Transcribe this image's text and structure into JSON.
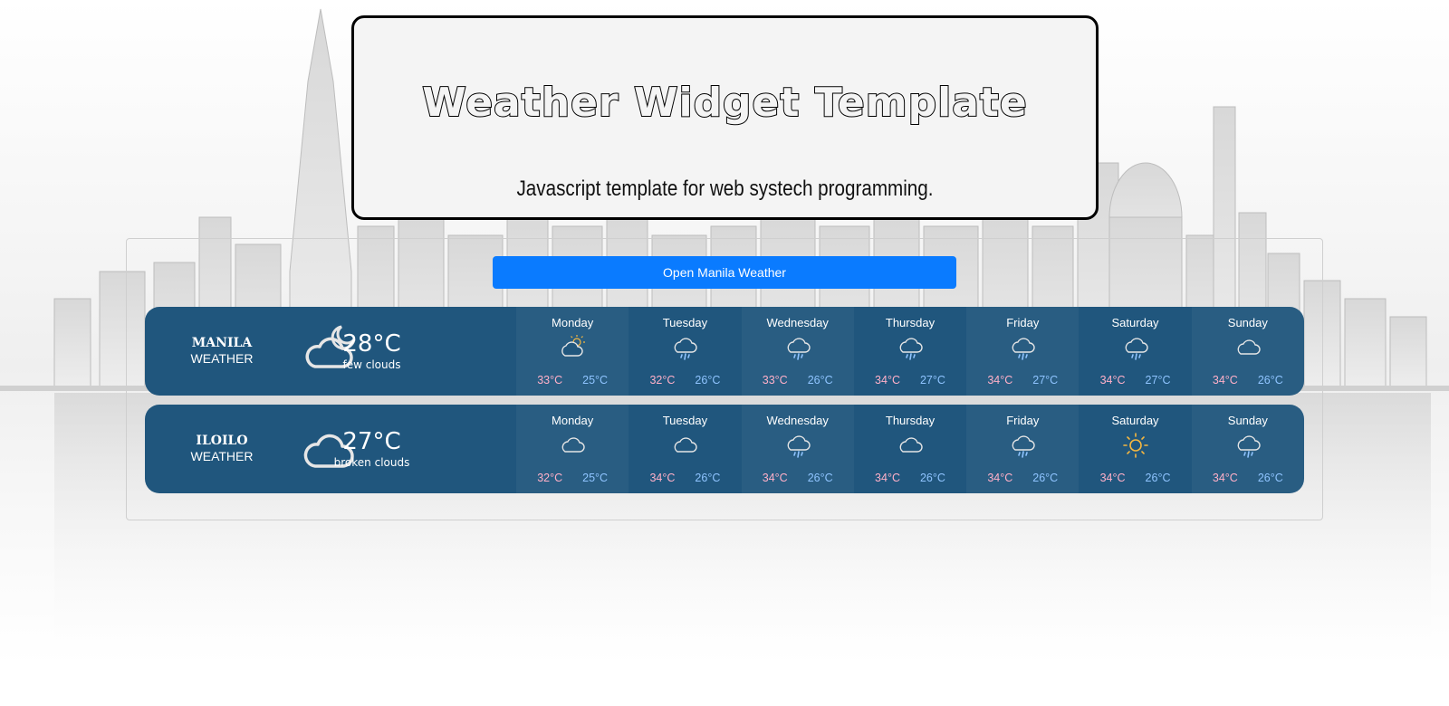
{
  "header": {
    "title": "Weather Widget Template",
    "subtitle": "Javascript template for web systech programming."
  },
  "open_button": {
    "label": "Open Manila Weather"
  },
  "colors": {
    "button": "#0a7bff",
    "card": "#20567d",
    "high_temp": "#ffb0c8",
    "low_temp": "#8fc4ff",
    "sun": "#f5b740"
  },
  "cities": [
    {
      "name": "MANILA",
      "sub": "WEATHER",
      "icon": "cloud-moon-icon",
      "temp": "28°C",
      "desc": "few clouds",
      "forecast": [
        {
          "day": "Monday",
          "icon": "partly-sunny-icon",
          "hi": "33°C",
          "lo": "25°C"
        },
        {
          "day": "Tuesday",
          "icon": "rain-cloud-icon",
          "hi": "32°C",
          "lo": "26°C"
        },
        {
          "day": "Wednesday",
          "icon": "rain-cloud-icon",
          "hi": "33°C",
          "lo": "26°C"
        },
        {
          "day": "Thursday",
          "icon": "rain-cloud-icon",
          "hi": "34°C",
          "lo": "27°C"
        },
        {
          "day": "Friday",
          "icon": "rain-cloud-icon",
          "hi": "34°C",
          "lo": "27°C"
        },
        {
          "day": "Saturday",
          "icon": "rain-cloud-icon",
          "hi": "34°C",
          "lo": "27°C"
        },
        {
          "day": "Sunday",
          "icon": "cloud-icon",
          "hi": "34°C",
          "lo": "26°C"
        }
      ]
    },
    {
      "name": "ILOILO",
      "sub": "WEATHER",
      "icon": "cloud-icon",
      "temp": "27°C",
      "desc": "broken clouds",
      "forecast": [
        {
          "day": "Monday",
          "icon": "cloud-icon",
          "hi": "32°C",
          "lo": "25°C"
        },
        {
          "day": "Tuesday",
          "icon": "cloud-icon",
          "hi": "34°C",
          "lo": "26°C"
        },
        {
          "day": "Wednesday",
          "icon": "rain-cloud-icon",
          "hi": "34°C",
          "lo": "26°C"
        },
        {
          "day": "Thursday",
          "icon": "cloud-icon",
          "hi": "34°C",
          "lo": "26°C"
        },
        {
          "day": "Friday",
          "icon": "rain-cloud-icon",
          "hi": "34°C",
          "lo": "26°C"
        },
        {
          "day": "Saturday",
          "icon": "sun-icon",
          "hi": "34°C",
          "lo": "26°C"
        },
        {
          "day": "Sunday",
          "icon": "rain-cloud-icon",
          "hi": "34°C",
          "lo": "26°C"
        }
      ]
    }
  ]
}
